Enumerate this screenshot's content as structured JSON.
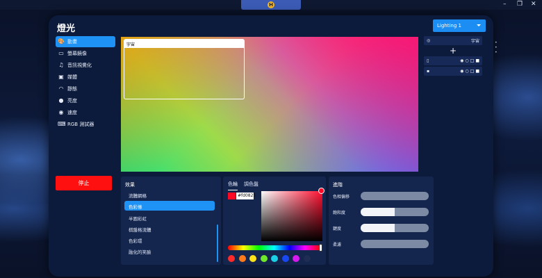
{
  "window": {
    "controls": [
      "–",
      "❐",
      "✕"
    ]
  },
  "app": {
    "title": "燈光",
    "device_select": "Lighting 1"
  },
  "sidebar": {
    "items": [
      {
        "label": "動畫",
        "icon": "palette-icon",
        "active": true
      },
      {
        "label": "螢幕鏡像",
        "icon": "monitor-icon",
        "active": false
      },
      {
        "label": "音訊視覺化",
        "icon": "music-note-icon",
        "active": false
      },
      {
        "label": "媒體",
        "icon": "image-icon",
        "active": false
      },
      {
        "label": "靜態",
        "icon": "static-icon",
        "active": false
      },
      {
        "label": "亮度",
        "icon": "bulb-icon",
        "active": false
      },
      {
        "label": "速度",
        "icon": "speed-icon",
        "active": false
      },
      {
        "label": "RGB 測試器",
        "icon": "keyboard-icon",
        "active": false
      }
    ],
    "stop_label": "停止"
  },
  "preview": {
    "zone_label": "宇宙"
  },
  "layers": {
    "header_label": "宇宙",
    "add_label": "+",
    "menu": "• • •"
  },
  "effects": {
    "title": "效果",
    "items": [
      "流體網格",
      "色彩條",
      "半圓彩虹",
      "棋盤格流體",
      "色彩環",
      "融化的笑臉"
    ],
    "active_index": 1
  },
  "color": {
    "tabs": [
      "色輪",
      "調色盤"
    ],
    "hex_value": "#fd0825",
    "current": "#fd0825",
    "swatches": [
      "#ff2a2a",
      "#ff7a1a",
      "#ffe21a",
      "#6ee82b",
      "#1bd0e6",
      "#1a48f0",
      "#d61af0",
      "#1f2d55"
    ]
  },
  "advanced": {
    "title": "進階",
    "rows": [
      {
        "label": "色相偏移",
        "fill": 0
      },
      {
        "label": "飽和度",
        "fill": 0.5
      },
      {
        "label": "鍵度",
        "fill": 0.5
      },
      {
        "label": "柔濾",
        "fill": 0
      }
    ]
  }
}
